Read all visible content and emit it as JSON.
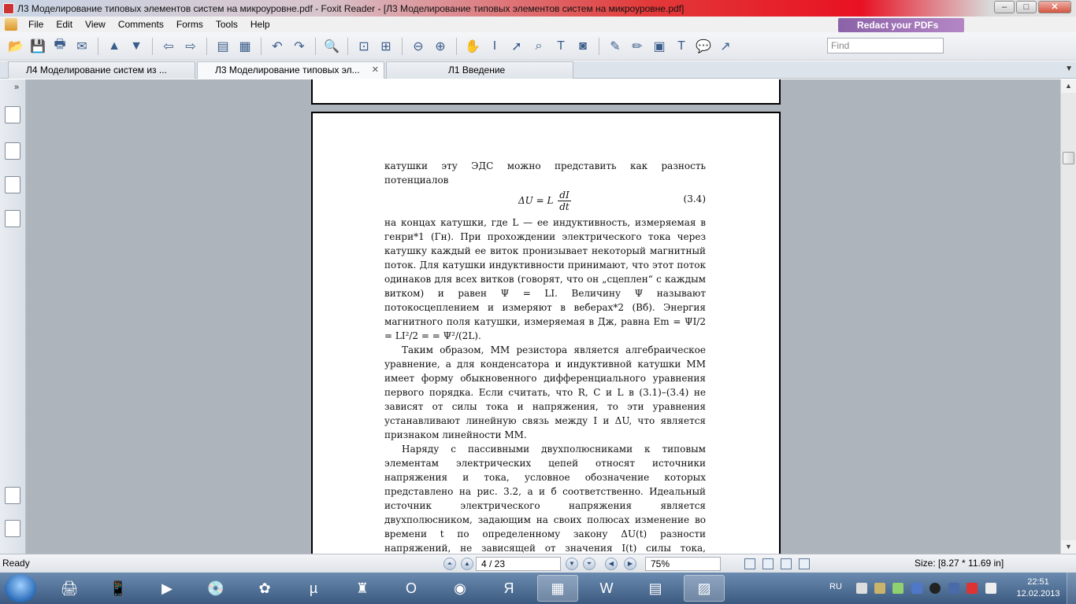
{
  "window": {
    "title": "Л3 Моделирование типовых элементов систем на микроуровне.pdf - Foxit Reader - [Л3 Моделирование типовых элементов систем на микроуровне.pdf]"
  },
  "menu": [
    "File",
    "Edit",
    "View",
    "Comments",
    "Forms",
    "Tools",
    "Help"
  ],
  "promo": "Redact your PDFs",
  "toolbar": {
    "find_placeholder": "Find"
  },
  "tabs": [
    {
      "label": "Л4  Моделирование систем из ..."
    },
    {
      "label": "Л3 Моделирование типовых эл..."
    },
    {
      "label": "Л1 Введение"
    }
  ],
  "document": {
    "p1": "катушки эту ЭДС можно представить как разность потенциалов",
    "formula_lhs": "ΔU = L",
    "formula_num": "dI",
    "formula_den": "dt",
    "formula_no": "(3.4)",
    "p2": "на концах катушки, где L — ее индуктивность, измеряемая в генри*1 (Гн). При прохождении электрического тока через катушку каждый ее виток пронизывает некоторый магнитный поток. Для катушки индуктивности принимают, что этот поток одинаков для всех витков (говорят, что он „сцеплен“ с каждым витком) и равен Ψ = LI. Величину Ψ называют потокосцеплением и измеряют в веберах*2 (Вб). Энергия магнитного поля катушки, измеряемая в Дж, равна Em = ΨI/2 = LI²/2 = = Ψ²/(2L).",
    "p3": "Таким образом, ММ резистора является алгебраическое уравнение, а для конденсатора и индуктивной катушки ММ имеет форму обыкновенного дифференциального уравнения первого порядка. Если считать, что R, C и L в (3.1)–(3.4) не зависят от силы тока и напряжения, то эти уравнения устанавливают линейную связь между I и ΔU, что является признаком линейности ММ.",
    "p4": "Наряду с пассивными двухполюсниками к типовым элементам электрических цепей относят источники напряжения и тока, условное обозначение которых представлено на рис. 3.2, а и б соответственно. Идеальный источник электрического напряжения является двухполюсником, задающим на своих полюсах изменение во времени t по определенному закону ΔU(t) разности напряжений, не зависящей от значения I(t) силы тока, протекающего через него. Это означает, что такой источник"
  },
  "statusbar": {
    "ready": "Ready",
    "page": "4 / 23",
    "zoom": "75%",
    "size": "Size: [8.27 * 11.69 in]"
  },
  "taskbar": {
    "lang": "RU",
    "time": "22:51",
    "date": "12.02.2013"
  }
}
